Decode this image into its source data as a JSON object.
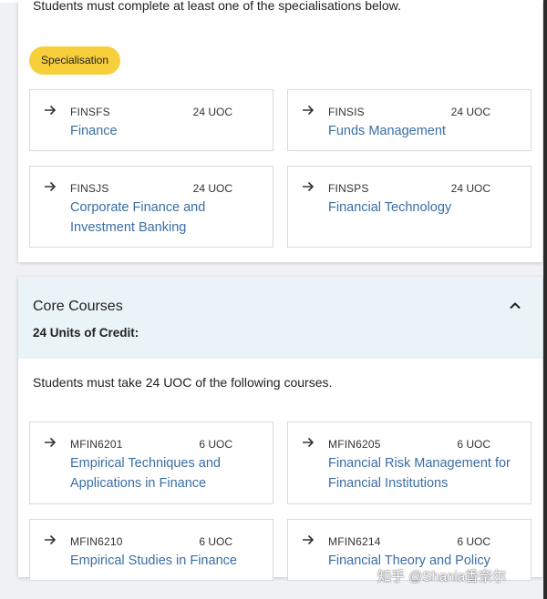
{
  "specialisations": {
    "intro": "Students must complete at least one of the specialisations below.",
    "pill_label": "Specialisation",
    "items": [
      {
        "code": "FINSFS",
        "uoc": "24 UOC",
        "title_lines": [
          "Finance"
        ]
      },
      {
        "code": "FINSIS",
        "uoc": "24 UOC",
        "title_lines": [
          "Funds Management"
        ]
      },
      {
        "code": "FINSJS",
        "uoc": "24 UOC",
        "title_lines": [
          "Corporate Finance and",
          "Investment Banking"
        ]
      },
      {
        "code": "FINSPS",
        "uoc": "24 UOC",
        "title_lines": [
          "Financial Technology"
        ]
      }
    ]
  },
  "core": {
    "title": "Core Courses",
    "units": "24 Units of Credit:",
    "intro": "Students must take 24 UOC of the following courses.",
    "items": [
      {
        "code": "MFIN6201",
        "uoc": "6 UOC",
        "title_lines": [
          "Empirical Techniques and",
          "Applications in Finance"
        ]
      },
      {
        "code": "MFIN6205",
        "uoc": "6 UOC",
        "title_lines": [
          "Financial Risk Management for",
          "Financial Institutions"
        ]
      },
      {
        "code": "MFIN6210",
        "uoc": "6 UOC",
        "title_lines": [
          "Empirical Studies in Finance"
        ]
      },
      {
        "code": "MFIN6214",
        "uoc": "6 UOC",
        "title_lines": [
          "Financial Theory and Policy"
        ]
      }
    ]
  },
  "watermark": "知乎 @Shania香奈尔",
  "colors": {
    "pill": "#f6cf3b",
    "link": "#3a6ea5",
    "header_bg": "#e9f3f8"
  },
  "icons": {
    "tile_arrow": "arrow-right-icon",
    "collapse": "chevron-up-icon"
  }
}
